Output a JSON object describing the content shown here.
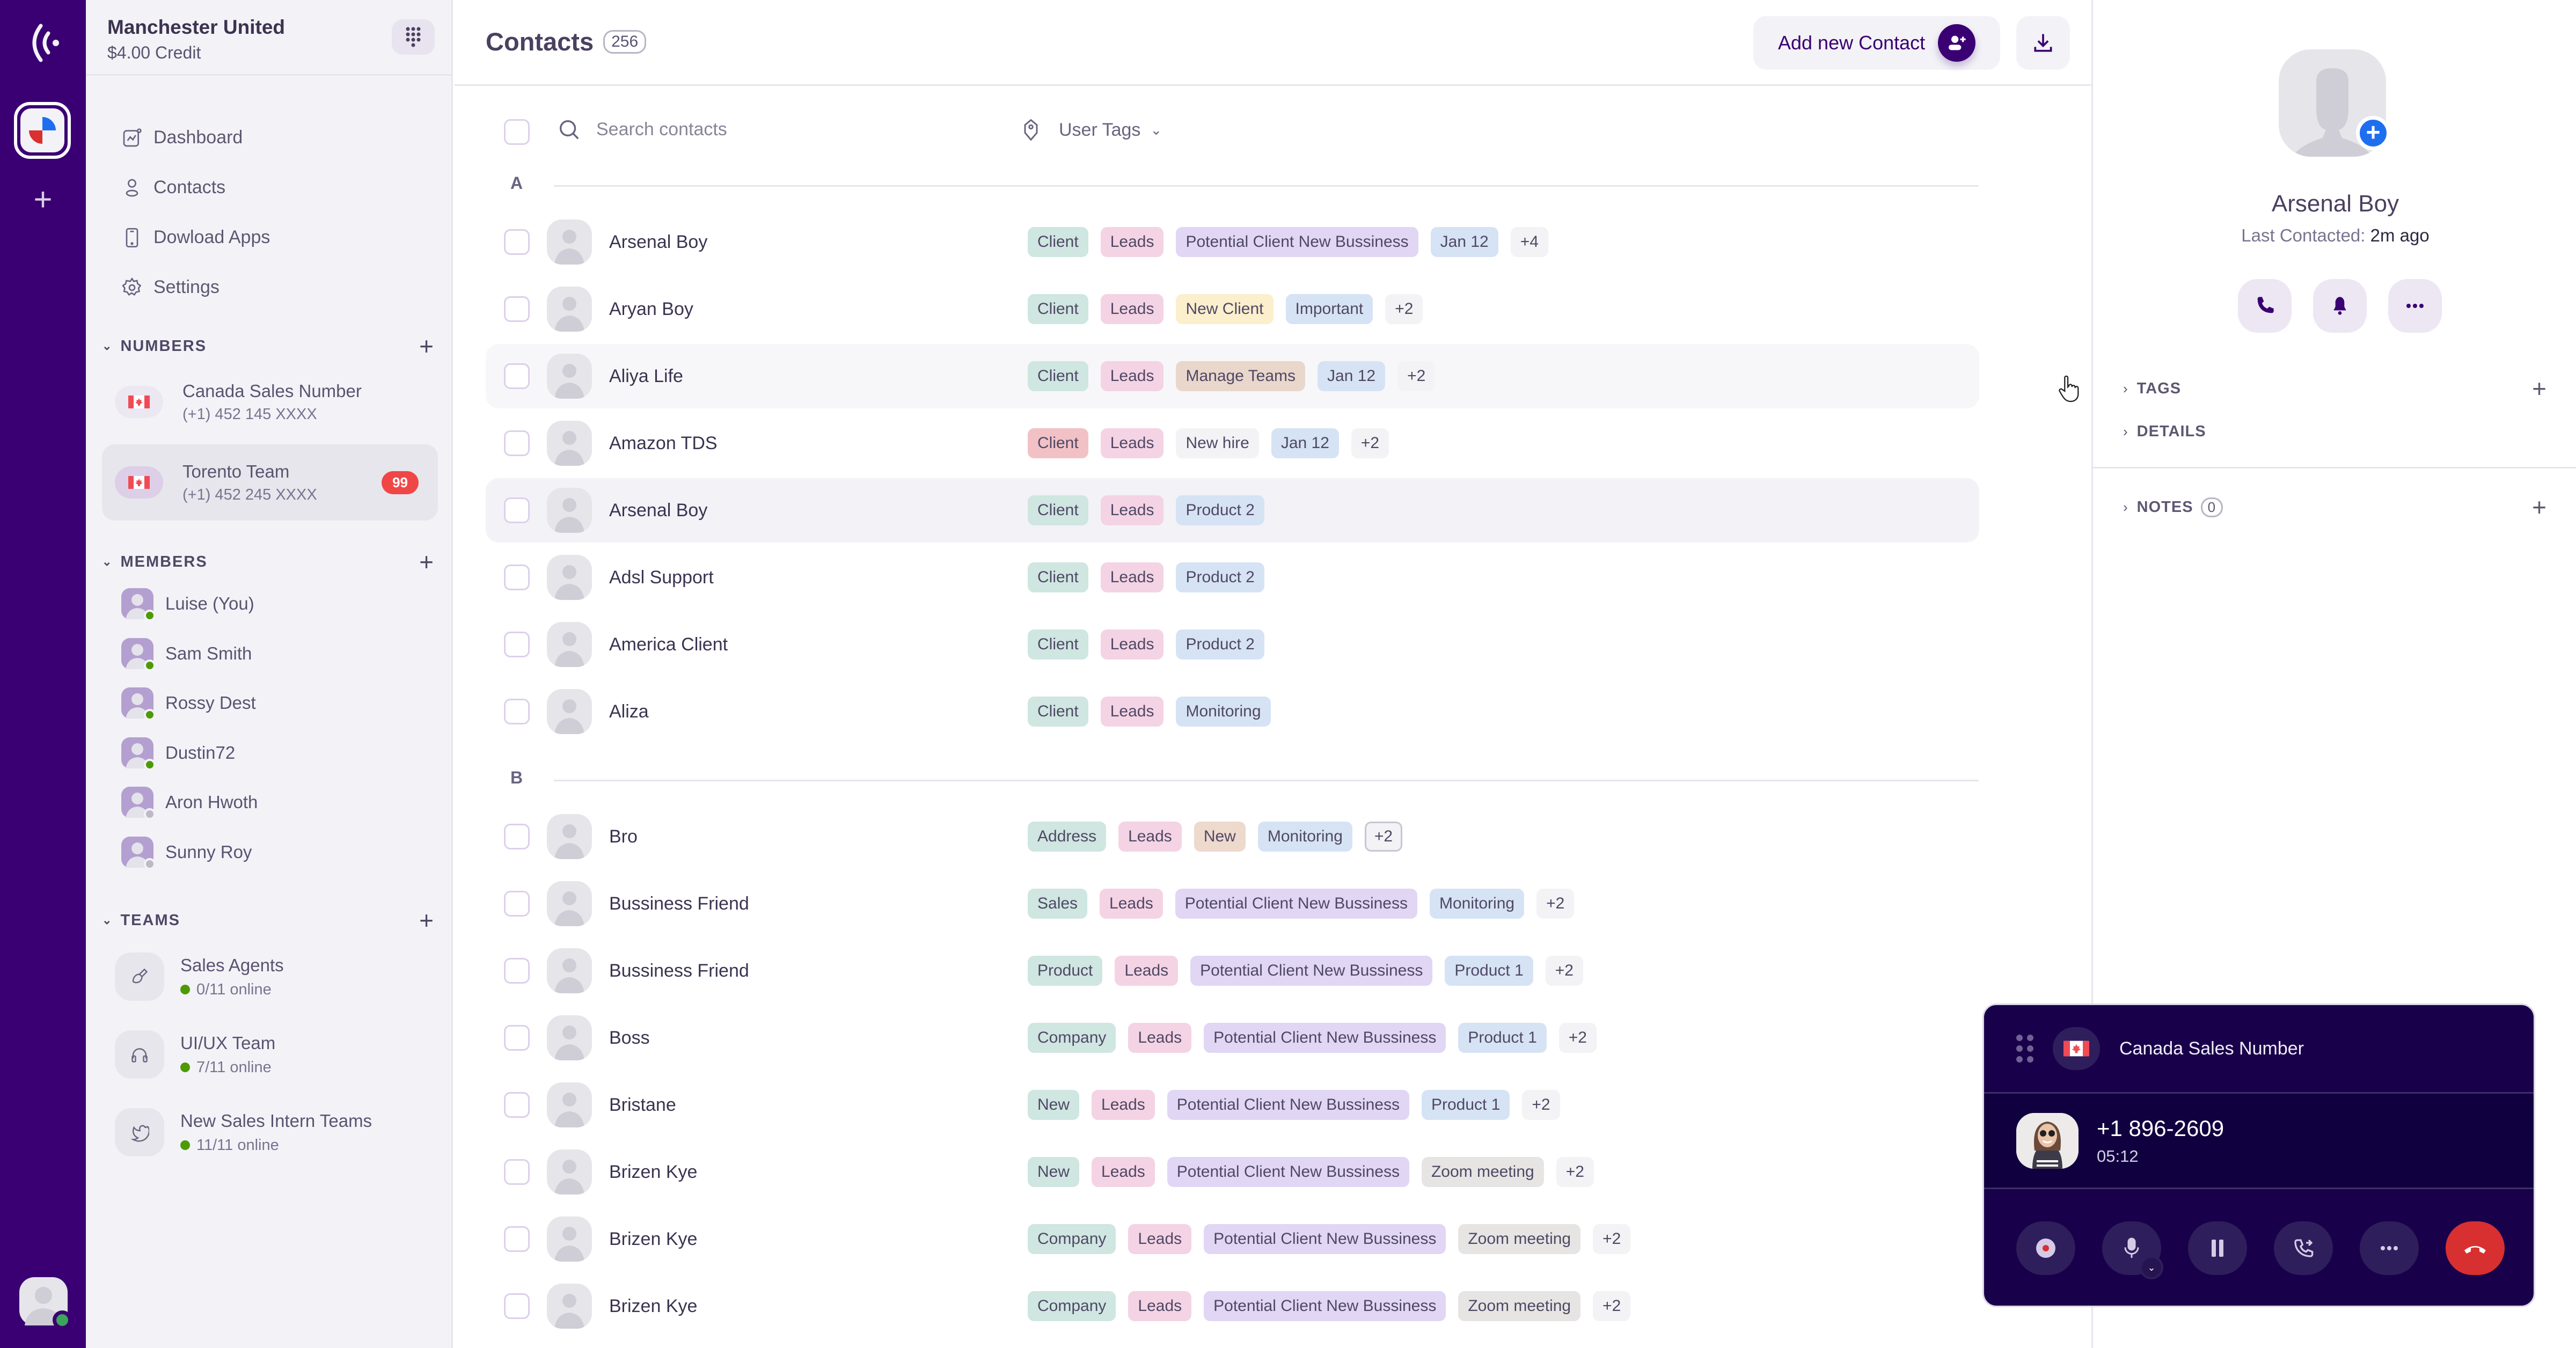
{
  "workspace": {
    "name": "Manchester United",
    "credit": "$4.00 Credit"
  },
  "nav": [
    {
      "label": "Dashboard",
      "icon": "dashboard-icon"
    },
    {
      "label": "Contacts",
      "icon": "contacts-icon"
    },
    {
      "label": "Dowload Apps",
      "icon": "phone-device-icon"
    },
    {
      "label": "Settings",
      "icon": "gear-icon"
    }
  ],
  "numbers": {
    "heading": "NUMBERS",
    "items": [
      {
        "title": "Canada Sales Number",
        "number": "(+1) 452 145 XXXX",
        "badge": null
      },
      {
        "title": "Torento Team",
        "number": "(+1) 452 245 XXXX",
        "badge": "99"
      }
    ]
  },
  "members": {
    "heading": "MEMBERS",
    "items": [
      {
        "name": "Luise (You)",
        "status": "online"
      },
      {
        "name": "Sam Smith",
        "status": "online"
      },
      {
        "name": "Rossy Dest",
        "status": "online"
      },
      {
        "name": "Dustin72",
        "status": "online"
      },
      {
        "name": "Aron Hwoth",
        "status": "offline"
      },
      {
        "name": "Sunny Roy",
        "status": "offline"
      }
    ]
  },
  "teams": {
    "heading": "TEAMS",
    "items": [
      {
        "name": "Sales Agents",
        "online": "0/11 online",
        "icon": "brush-icon"
      },
      {
        "name": "UI/UX Team",
        "online": "7/11 online",
        "icon": "headphones-icon"
      },
      {
        "name": "New Sales Intern Teams",
        "online": "11/11 online",
        "icon": "twitter-bird-icon"
      }
    ]
  },
  "main": {
    "title": "Contacts",
    "count": "256",
    "add_contact_label": "Add new Contact",
    "search_placeholder": "Search contacts",
    "user_tags_label": "User Tags",
    "groups": [
      {
        "letter": "A",
        "contacts": [
          {
            "name": "Arsenal Boy",
            "state": "",
            "tags": [
              [
                "Client",
                "green"
              ],
              [
                "Leads",
                "pink"
              ],
              [
                "Potential Client New Bussiness",
                "purple"
              ],
              [
                "Jan 12",
                "blue"
              ]
            ],
            "more": "+4"
          },
          {
            "name": "Aryan Boy",
            "state": "",
            "tags": [
              [
                "Client",
                "green"
              ],
              [
                "Leads",
                "pink"
              ],
              [
                "New Client",
                "yellow"
              ],
              [
                "Important",
                "blue"
              ]
            ],
            "more": "+2"
          },
          {
            "name": "Aliya Life",
            "state": "hover",
            "tags": [
              [
                "Client",
                "green"
              ],
              [
                "Leads",
                "pink"
              ],
              [
                "Manage Teams",
                "tan"
              ],
              [
                "Jan 12",
                "blue"
              ]
            ],
            "more": "+2"
          },
          {
            "name": "Amazon TDS",
            "state": "",
            "tags": [
              [
                "Client",
                "red"
              ],
              [
                "Leads",
                "pink"
              ],
              [
                "New hire",
                "gray"
              ],
              [
                "Jan 12",
                "blue"
              ]
            ],
            "more": "+2"
          },
          {
            "name": "Arsenal Boy",
            "state": "selected",
            "tags": [
              [
                "Client",
                "green"
              ],
              [
                "Leads",
                "pink"
              ],
              [
                "Product 2",
                "blue"
              ]
            ],
            "more": null
          },
          {
            "name": "Adsl Support",
            "state": "",
            "tags": [
              [
                "Client",
                "green"
              ],
              [
                "Leads",
                "pink"
              ],
              [
                "Product 2",
                "blue"
              ]
            ],
            "more": null
          },
          {
            "name": "America Client",
            "state": "",
            "tags": [
              [
                "Client",
                "green"
              ],
              [
                "Leads",
                "pink"
              ],
              [
                "Product 2",
                "blue"
              ]
            ],
            "more": null
          },
          {
            "name": "Aliza",
            "state": "",
            "tags": [
              [
                "Client",
                "green"
              ],
              [
                "Leads",
                "pink"
              ],
              [
                "Monitoring",
                "blue"
              ]
            ],
            "more": null
          }
        ]
      },
      {
        "letter": "B",
        "contacts": [
          {
            "name": "Bro",
            "state": "",
            "tags": [
              [
                "Address",
                "green"
              ],
              [
                "Leads",
                "pink"
              ],
              [
                "New",
                "peach"
              ],
              [
                "Monitoring",
                "blue"
              ]
            ],
            "more": "+2",
            "more_outlined": true
          },
          {
            "name": "Bussiness Friend",
            "state": "",
            "tags": [
              [
                "Sales",
                "green"
              ],
              [
                "Leads",
                "pink"
              ],
              [
                "Potential Client New Bussiness",
                "purple"
              ],
              [
                "Monitoring",
                "blue"
              ]
            ],
            "more": "+2"
          },
          {
            "name": "Bussiness Friend",
            "state": "",
            "tags": [
              [
                "Product",
                "green"
              ],
              [
                "Leads",
                "pink"
              ],
              [
                "Potential Client New Bussiness",
                "purple"
              ],
              [
                "Product 1",
                "blue"
              ]
            ],
            "more": "+2"
          },
          {
            "name": "Boss",
            "state": "",
            "tags": [
              [
                "Company",
                "green"
              ],
              [
                "Leads",
                "pink"
              ],
              [
                "Potential Client New Bussiness",
                "purple"
              ],
              [
                "Product 1",
                "blue"
              ]
            ],
            "more": "+2"
          },
          {
            "name": "Bristane",
            "state": "",
            "tags": [
              [
                "New",
                "green"
              ],
              [
                "Leads",
                "pink"
              ],
              [
                "Potential Client New Bussiness",
                "purple"
              ],
              [
                "Product 1",
                "blue"
              ]
            ],
            "more": "+2"
          },
          {
            "name": "Brizen Kye",
            "state": "",
            "tags": [
              [
                "New",
                "green"
              ],
              [
                "Leads",
                "pink"
              ],
              [
                "Potential Client New Bussiness",
                "purple"
              ],
              [
                "Zoom meeting",
                "stone"
              ]
            ],
            "more": "+2"
          },
          {
            "name": "Brizen Kye",
            "state": "",
            "tags": [
              [
                "Company",
                "green"
              ],
              [
                "Leads",
                "pink"
              ],
              [
                "Potential Client New Bussiness",
                "purple"
              ],
              [
                "Zoom meeting",
                "stone"
              ]
            ],
            "more": "+2"
          },
          {
            "name": "Brizen Kye",
            "state": "",
            "tags": [
              [
                "Company",
                "green"
              ],
              [
                "Leads",
                "pink"
              ],
              [
                "Potential Client New Bussiness",
                "purple"
              ],
              [
                "Zoom meeting",
                "stone"
              ]
            ],
            "more": "+2"
          }
        ]
      }
    ]
  },
  "tag_colors": {
    "green": "#cfe6e1",
    "pink": "#f4d3e4",
    "purple": "#e1d6f4",
    "blue": "#d6e3f5",
    "yellow": "#fbefcd",
    "tan": "#e9d7cc",
    "red": "#f2c1c6",
    "gray": "#f3f2f5",
    "peach": "#eed9cd",
    "stone": "#e6e5e3"
  },
  "detail": {
    "name": "Arsenal Boy",
    "last_contacted_label": "Last Contacted:",
    "last_contacted_value": "2m ago",
    "sections": {
      "tags": "TAGS",
      "details": "DETAILS",
      "notes": "NOTES",
      "notes_count": "0"
    }
  },
  "call": {
    "line_name": "Canada Sales Number",
    "number": "+1 896-2609",
    "duration": "05:12"
  },
  "colors": {
    "brand": "#3a0073",
    "call_bg": "#19004a",
    "end_call": "#d83030",
    "badge": "#f04646",
    "online": "#4e9a06",
    "add_photo": "#1e6ef0"
  }
}
